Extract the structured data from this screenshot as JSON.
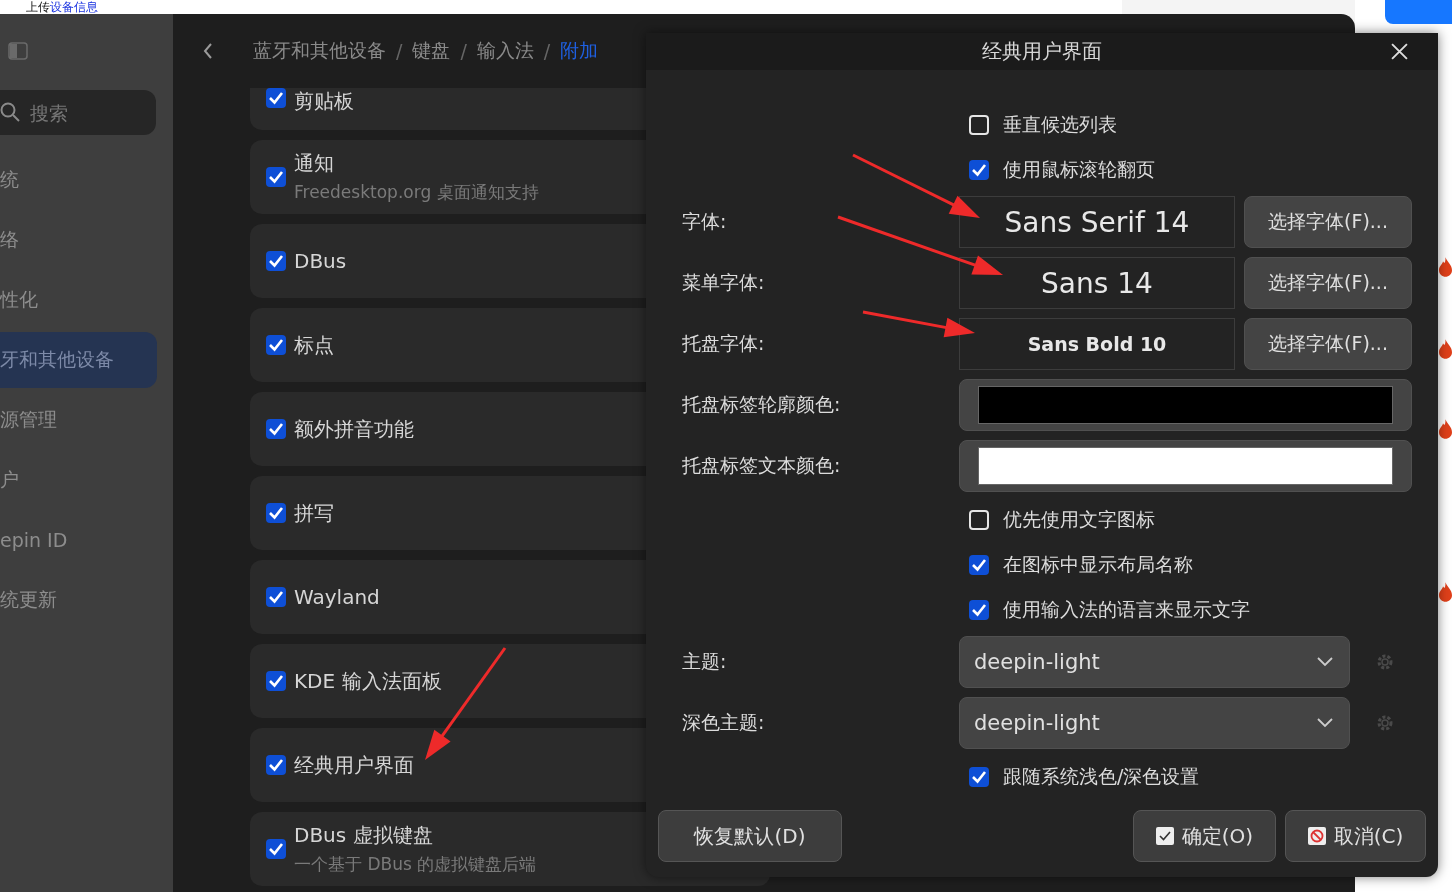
{
  "browser_strip": {
    "text": "上传",
    "link": "设备信息"
  },
  "settings": {
    "search": {
      "placeholder": "搜索"
    },
    "sidebar": {
      "items": [
        {
          "label": "统",
          "selected": false
        },
        {
          "label": "络",
          "selected": false
        },
        {
          "label": "性化",
          "selected": false
        },
        {
          "label": "牙和其他设备",
          "selected": true
        },
        {
          "label": "源管理",
          "selected": false
        },
        {
          "label": "户",
          "selected": false
        },
        {
          "label": "epin ID",
          "selected": false
        },
        {
          "label": "统更新",
          "selected": false
        }
      ]
    },
    "breadcrumb": [
      {
        "label": "蓝牙和其他设备",
        "selected": false
      },
      {
        "separator": "/",
        "label": "键盘",
        "selected": false
      },
      {
        "separator": "/",
        "label": "输入法",
        "selected": false
      },
      {
        "separator": "/",
        "label": "附加",
        "selected": true
      }
    ],
    "addons": [
      {
        "label": "剪贴板",
        "checked": true
      },
      {
        "label": "通知",
        "description": "Freedesktop.org 桌面通知支持",
        "checked": true
      },
      {
        "label": "DBus",
        "checked": true
      },
      {
        "label": "标点",
        "checked": true
      },
      {
        "label": "额外拼音功能",
        "checked": true
      },
      {
        "label": "拼写",
        "checked": true
      },
      {
        "label": "Wayland",
        "checked": true
      },
      {
        "label": "KDE 输入法面板",
        "checked": true
      },
      {
        "label": "经典用户界面",
        "checked": true
      },
      {
        "label": "DBus 虚拟键盘",
        "description": "一个基于 DBus 的虚拟键盘后端",
        "checked": true
      }
    ]
  },
  "dialog": {
    "title": "经典用户界面",
    "rows": [
      {
        "kind": "checkbox",
        "label": "垂直候选列表",
        "checked": false
      },
      {
        "kind": "checkbox",
        "label": "使用鼠标滚轮翻页",
        "checked": true
      },
      {
        "kind": "font",
        "label": "字体:",
        "value": "Sans Serif 14",
        "button": "选择字体(F)..."
      },
      {
        "kind": "font",
        "label": "菜单字体:",
        "value": "Sans 14",
        "button": "选择字体(F)..."
      },
      {
        "kind": "font",
        "label": "托盘字体:",
        "value": "Sans Bold 10",
        "button": "选择字体(F)..."
      },
      {
        "kind": "color",
        "label": "托盘标签轮廓颜色:",
        "color": "#000000"
      },
      {
        "kind": "color",
        "label": "托盘标签文本颜色:",
        "color": "#ffffff"
      },
      {
        "kind": "checkbox",
        "label": "优先使用文字图标",
        "checked": false
      },
      {
        "kind": "checkbox",
        "label": "在图标中显示布局名称",
        "checked": true
      },
      {
        "kind": "checkbox",
        "label": "使用输入法的语言来显示文字",
        "checked": true
      },
      {
        "kind": "combo",
        "label": "主题:",
        "value": "deepin-light"
      },
      {
        "kind": "combo",
        "label": "深色主题:",
        "value": "deepin-light"
      },
      {
        "kind": "checkbox",
        "label": "跟随系统浅色/深色设置",
        "checked": true
      }
    ],
    "buttons": [
      {
        "kind": "restore",
        "label": "恢复默认(D)"
      },
      {
        "kind": "ok",
        "label": "确定(O)"
      },
      {
        "kind": "cancel",
        "label": "取消(C)"
      }
    ]
  }
}
